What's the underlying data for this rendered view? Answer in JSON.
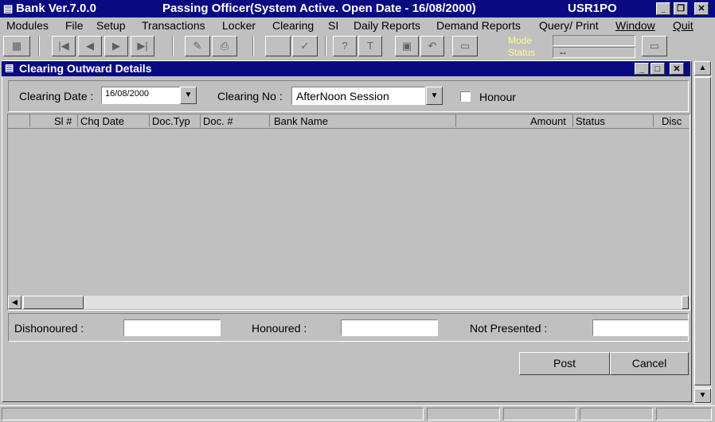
{
  "app": {
    "title": "Bank Ver.7.0.0",
    "subtitle": "Passing Officer(System Active. Open Date - 16/08/2000)",
    "user": "USR1PO"
  },
  "window_controls": {
    "minimize": "_",
    "restore": "🗗",
    "close": "✕"
  },
  "menu": [
    "Modules",
    "File",
    "Setup",
    "Transactions",
    "Locker",
    "Clearing",
    "SI",
    "Daily Reports",
    "Demand Reports",
    "Query/ Print",
    "Window",
    "Quit"
  ],
  "toolbar": {
    "mode_label": "Mode",
    "status_label": "Status",
    "status_value": "--"
  },
  "child_window": {
    "title": "Clearing Outward Details"
  },
  "form": {
    "clearing_date_label": "Clearing Date :",
    "clearing_date_value": "16/08/2000",
    "clearing_no_label": "Clearing No :",
    "clearing_no_value": "AfterNoon Session",
    "honour_label": "Honour",
    "honour_checked": false
  },
  "grid": {
    "columns": [
      "Sl #",
      "Chq Date",
      "Doc.Typ",
      "Doc. #",
      "Bank Name",
      "Amount",
      "Status",
      "Disc"
    ],
    "rows": []
  },
  "totals": {
    "dishonoured_label": "Dishonoured :",
    "dishonoured_value": "",
    "honoured_label": "Honoured :",
    "honoured_value": "",
    "not_presented_label": "Not Presented :",
    "not_presented_value": ""
  },
  "buttons": {
    "post": "Post",
    "cancel": "Cancel"
  },
  "icons": {
    "arrow_down": "▼",
    "arrow_up": "▲",
    "arrow_left": "◀",
    "arrow_right": "▶"
  }
}
